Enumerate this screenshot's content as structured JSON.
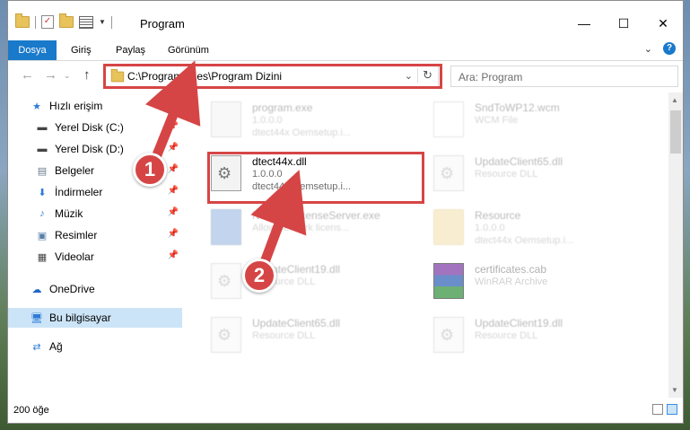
{
  "window": {
    "title": "Program"
  },
  "ribbon": {
    "tabs": [
      "Dosya",
      "Giriş",
      "Paylaş",
      "Görünüm"
    ]
  },
  "address": {
    "path": "C:\\Program Files\\Program Dizini"
  },
  "search": {
    "placeholder": "Ara: Program"
  },
  "sidebar": {
    "quick_access": "Hızlı erişim",
    "items": [
      "Yerel Disk (C:)",
      "Yerel Disk (D:)",
      "Belgeler",
      "İndirmeler",
      "Müzik",
      "Resimler",
      "Videolar"
    ],
    "onedrive": "OneDrive",
    "this_pc": "Bu bilgisayar",
    "network": "Ağ"
  },
  "files": [
    {
      "name": "program.exe",
      "line2": "1.0.0.0",
      "line3": "dtect44x Oemsetup.i...",
      "icon": "exe-icon"
    },
    {
      "name": "SndToWP12.wcm",
      "line2": "WCM File",
      "icon": "document-icon"
    },
    {
      "name": "dtect44x.dll",
      "line2": "1.0.0.0",
      "line3": "dtect44x Oemsetup.i...",
      "icon": "dll-icon"
    },
    {
      "name": "UpdateClient65.dll",
      "line2": "Resource DLL",
      "icon": "dll-icon"
    },
    {
      "name": "NetworkLicenseServer.exe",
      "line2": "Allow network licens...",
      "icon": "network-exe-icon"
    },
    {
      "name": "Resource",
      "line2": "1.0.0.0",
      "line3": "dtect44x Oemsetup.i...",
      "icon": "folder-icon"
    },
    {
      "name": "UpdateClient19.dll",
      "line2": "Resource DLL",
      "icon": "dll-icon"
    },
    {
      "name": "certificates.cab",
      "line2": "WinRAR Archive",
      "icon": "winrar-icon"
    },
    {
      "name": "UpdateClient65.dll",
      "line2": "Resource DLL",
      "icon": "dll-icon"
    },
    {
      "name": "UpdateClient19.dll",
      "line2": "Resource DLL",
      "icon": "dll-icon"
    }
  ],
  "status": {
    "count": "200 öğe"
  },
  "annotations": {
    "step1": "1",
    "step2": "2"
  },
  "colors": {
    "accent": "#1979ca",
    "highlight": "#d64545",
    "selection": "#cce4f7"
  }
}
